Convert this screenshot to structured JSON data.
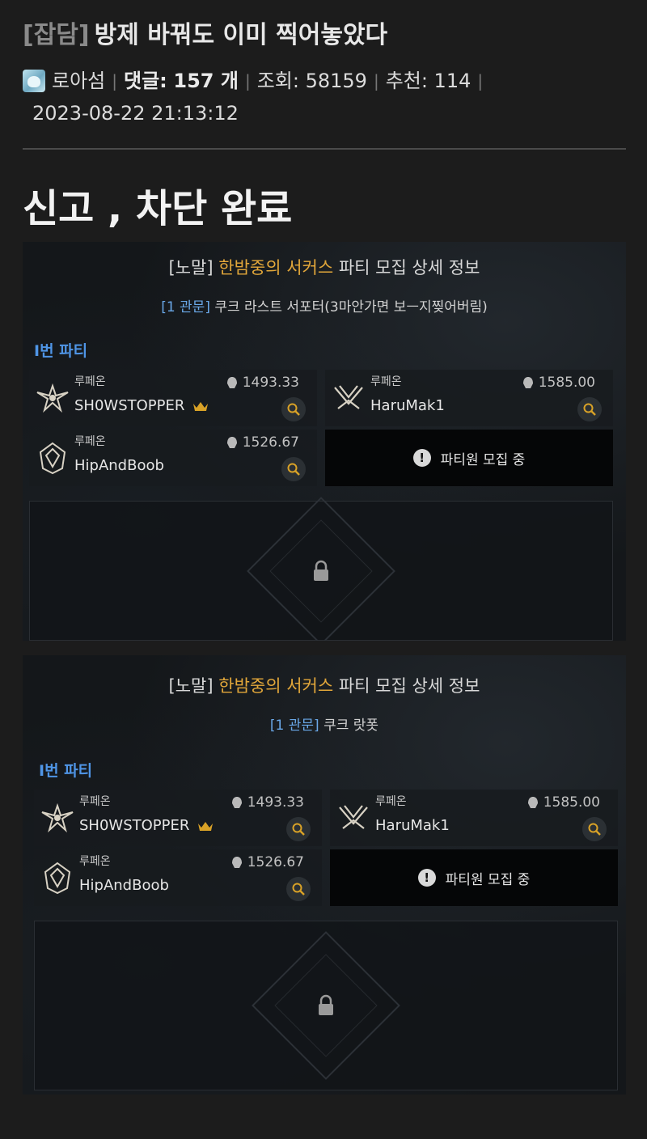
{
  "post": {
    "category": "[잡담]",
    "title": "방제 바꿔도 이미 찍어놓았다",
    "author": "로아섬",
    "comments_label": "댓글:",
    "comments_count": "157 개",
    "views": "조회: 58159",
    "recommends": "추천: 114",
    "datetime": "2023-08-22 21:13:12",
    "body_headline": "신고 , 차단 완료",
    "separator": "|"
  },
  "screenshots": [
    {
      "title_bracket": "[노말]",
      "party_name": "한밤중의 서커스",
      "title_suffix": "파티 모집 상세 정보",
      "sub_tag": "[1 관문]",
      "sub_text": "쿠크 라스트 서포터(3마안가면 보ㅡ지찢어버림)",
      "party_label": "I번 파티",
      "members": [
        {
          "class": "루페온",
          "ilvl": "1493.33",
          "name": "SH0WSTOPPER",
          "leader": true
        },
        {
          "class": "루페온",
          "ilvl": "1585.00",
          "name": "HaruMak1",
          "leader": false
        },
        {
          "class": "루페온",
          "ilvl": "1526.67",
          "name": "HipAndBoob",
          "leader": false
        }
      ],
      "recruiting": "파티원 모집 중"
    },
    {
      "title_bracket": "[노말]",
      "party_name": "한밤중의 서커스",
      "title_suffix": "파티 모집 상세 정보",
      "sub_tag": "[1 관문]",
      "sub_text": "쿠크 랏폿",
      "party_label": "I번 파티",
      "members": [
        {
          "class": "루페온",
          "ilvl": "1493.33",
          "name": "SH0WSTOPPER",
          "leader": true
        },
        {
          "class": "루페온",
          "ilvl": "1585.00",
          "name": "HaruMak1",
          "leader": false
        },
        {
          "class": "루페온",
          "ilvl": "1526.67",
          "name": "HipAndBoob",
          "leader": false
        }
      ],
      "recruiting": "파티원 모집 중"
    }
  ],
  "icons": {
    "avatar": "avatar-icon",
    "class_emblem": "class-emblem-icon",
    "helmet": "helmet-icon",
    "crown": "crown-icon",
    "magnifier": "magnifier-icon",
    "alert": "alert-icon",
    "lock": "lock-icon"
  },
  "colors": {
    "background": "#1c1c1c",
    "party_name": "#e2a73a",
    "party_label": "#4f95e6",
    "sub_tag": "#6aa8e8",
    "crown": "#d9a227"
  }
}
